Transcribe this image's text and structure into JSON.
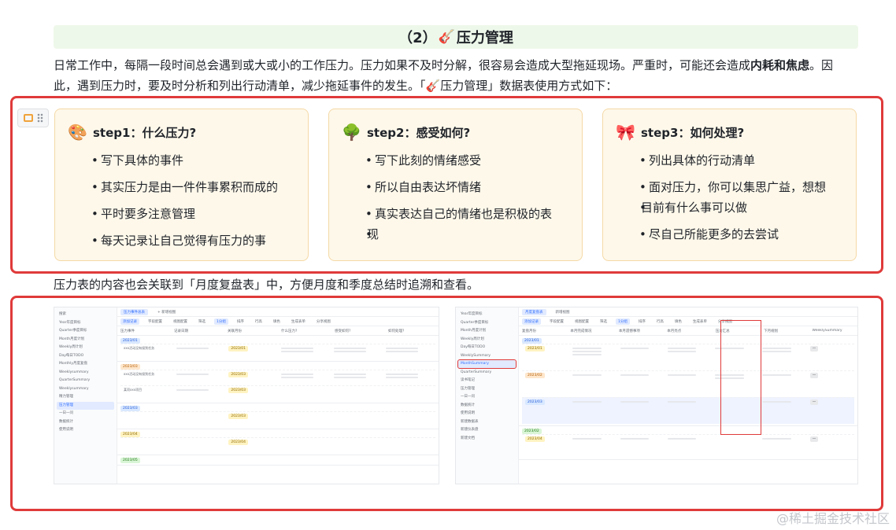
{
  "heading": {
    "prefix": "（2）",
    "icon": "guitar-icon",
    "title": "压力管理"
  },
  "intro": {
    "part1": "日常工作中，每隔一段时间总会遇到或大或小的工作压力。压力如果不及时分解，很容易会造成大型拖延现场。严重时，可能还会造成",
    "bold": "内耗和焦虑",
    "part2": "。因此，遇到压力时，要及时分析和列出行动清单，减少拖延事件的发生。「",
    "table_name": "压力管理",
    "part3": "」数据表使用方式如下："
  },
  "cards": [
    {
      "title": "step1：什么压力?",
      "icon": "palette-icon",
      "items": [
        "写下具体的事件",
        "其实压力是由一件件事累积而成的",
        "平时要多注意管理",
        "每天记录让自己觉得有压力的事"
      ]
    },
    {
      "title": "step2：感受如何?",
      "icon": "tree-icon",
      "items": [
        "写下此刻的情绪感受",
        "所以自由表达坏情绪",
        "真实表达自己的情绪也是积极的表",
        "现"
      ]
    },
    {
      "title": "step3：如何处理?",
      "icon": "gift-icon",
      "items": [
        "列出具体的行动清单",
        "面对压力，你可以集思广益，想想",
        "目前有什么事可以做",
        "尽自己所能更多的去尝试"
      ]
    }
  ],
  "outro": "压力表的内容也会关联到「月度复盘表」中，方便月度和季度总结时追溯和查看。",
  "shot1": {
    "sidebar": [
      "搜索",
      "Year年度目标",
      "Quarter季度目标",
      "Month月度计划",
      "Weekly周计划",
      "Day每日TODO",
      "Monthly月度复盘",
      "Weeklysummary",
      "QuarterSummary",
      "Weeklysummary",
      "精力管理",
      "压力管理",
      "一日一问",
      "数据统计",
      "使用说明"
    ],
    "active": 11,
    "tabs": [
      "压力事件总表",
      "+ 新增视图"
    ],
    "toolbar": [
      "添加记录",
      "字段配置",
      "视图配置",
      "筛选",
      "1分组",
      "排序",
      "行高",
      "填色",
      "生成表单",
      "分享视图"
    ],
    "columns": [
      "压力事件",
      "记录日期",
      "关联月份",
      "什么压力?",
      "感受如何?",
      "如何处理?"
    ],
    "groups": [
      {
        "tag": "2023/01",
        "color": "blue",
        "rows": [
          "xxx活动没有接到任务",
          "xxx",
          "xxx"
        ]
      },
      {
        "tag": "2023/03",
        "color": "orange",
        "rows": [
          "xxx活动没有接到任务",
          "某项xxx项目",
          "xxx"
        ]
      },
      {
        "tag": "2023/03",
        "color": "blue",
        "rows": [
          ""
        ]
      },
      {
        "tag": "2023/04",
        "color": "yellow",
        "rows": [
          ""
        ]
      },
      {
        "tag": "2023/05",
        "color": "green",
        "rows": [
          ""
        ]
      }
    ]
  },
  "shot2": {
    "sidebar": [
      "Year年度目标",
      "Quarter季度目标",
      "Month月度计划",
      "Weekly周计划",
      "Day每日TODO",
      "WeeklySummary",
      "MonthSummary",
      "QuarterSummary",
      "读书笔记",
      "压力管理",
      "一日一问",
      "数据统计",
      "使用说明",
      "新建数据表",
      "新建仪表盘",
      "新建文档"
    ],
    "active": 6,
    "tabs": [
      "月度复盘表",
      "新增视图"
    ],
    "toolbar": [
      "添加记录",
      "字段配置",
      "视图配置",
      "筛选",
      "1分组",
      "排序",
      "行高",
      "填色",
      "生成表单",
      "分享视图"
    ],
    "columns": [
      "复盘月份",
      "本月完成情况",
      "本月遗憾事项",
      "本月亮点",
      "压力汇总",
      "下月规划",
      "WeeklySummary"
    ],
    "groups": [
      {
        "tag": "2023/01",
        "color": "blue",
        "rows": [
          "2023/01",
          "2023/02",
          "2023/03"
        ]
      },
      {
        "tag": "2023/02",
        "color": "green",
        "rows": [
          "2023/04"
        ]
      }
    ]
  },
  "watermark": "@稀土掘金技术社区"
}
